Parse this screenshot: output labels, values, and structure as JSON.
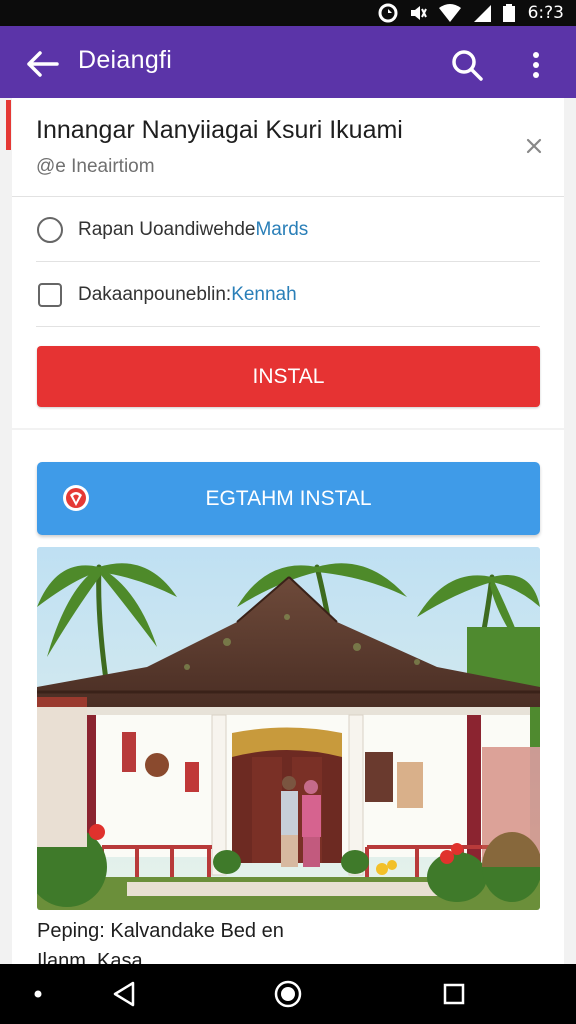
{
  "status_bar": {
    "time": "6:?3",
    "icons": [
      "sync-icon",
      "mute-icon",
      "wifi-icon",
      "signal-icon",
      "battery-icon"
    ]
  },
  "app_bar": {
    "title": "Deiangfi",
    "back_icon": "arrow-left-icon",
    "search_icon": "search-icon",
    "more_icon": "more-vert-icon",
    "color": "#5b34a8"
  },
  "card": {
    "title": "Innangar Nanyiiagai Ksuri Ikuami",
    "subtitle": "@e Ineairtiom",
    "close_icon": "close-icon",
    "accent_color": "#e53935",
    "options": [
      {
        "icon": "circle-outline-icon",
        "text": "Rapan Uoandiwehde ",
        "link": "Mards"
      },
      {
        "icon": "square-outline-icon",
        "text": "Dakaanpouneblin: ",
        "link": "Kennah"
      }
    ],
    "install_label": "INSTAL",
    "install_color": "#e63333"
  },
  "card2": {
    "install_label": "EGTAHM INSTAL",
    "install_icon": "shield-badge-icon",
    "install_color": "#3f9be8",
    "photo_icon": "house-photo-image",
    "caption_line1": "Peping: Kalvandake Bed en",
    "caption_line2": "Ilanm, Kasa"
  },
  "nav_bar": {
    "items": [
      "dot-icon",
      "back-triangle-icon",
      "home-circle-icon",
      "recents-square-icon"
    ]
  }
}
